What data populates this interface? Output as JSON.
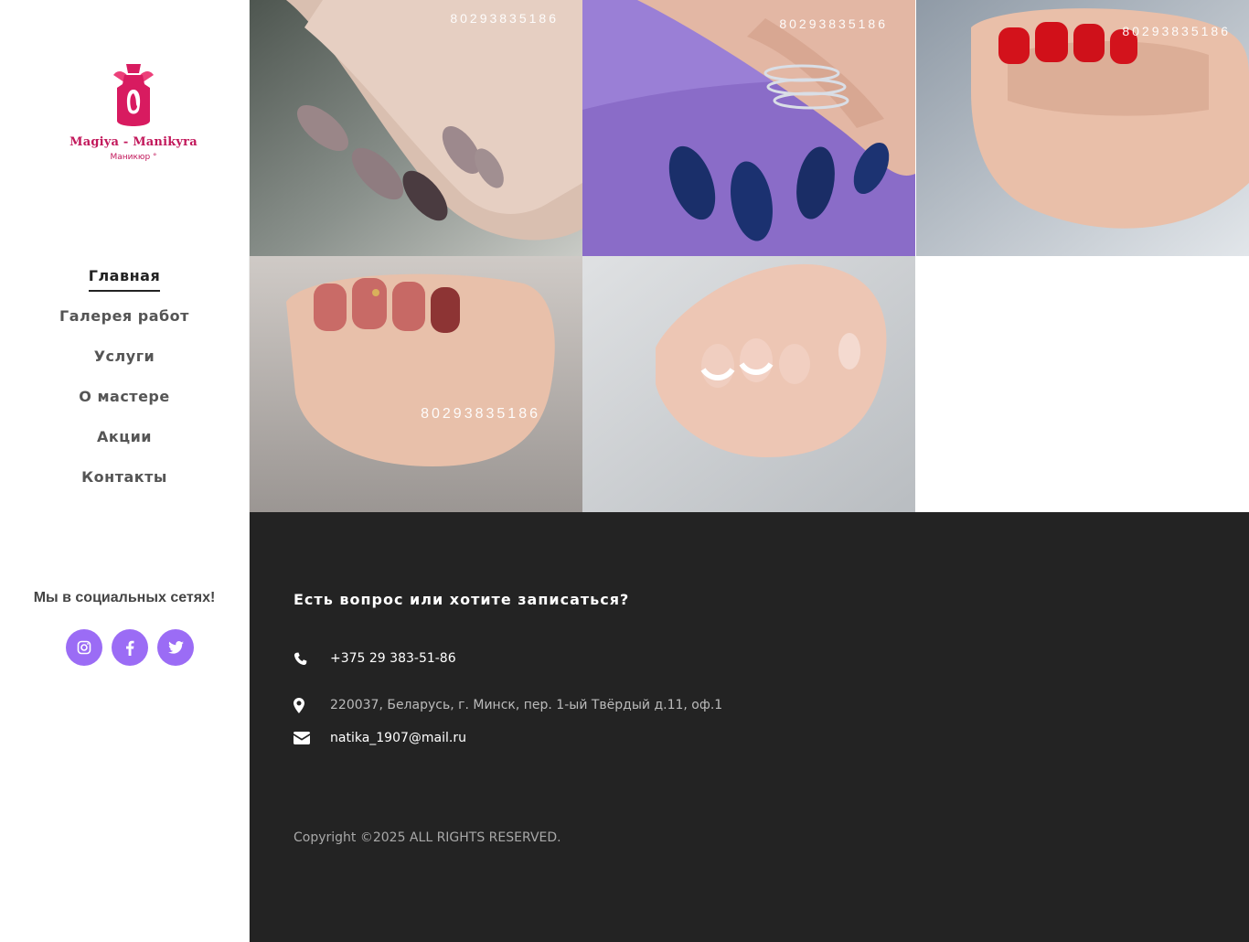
{
  "brand": {
    "name": "Magiya - Manikyra",
    "tagline": "Маникюр °"
  },
  "nav": {
    "items": [
      {
        "label": "Главная",
        "active": true
      },
      {
        "label": "Галерея работ"
      },
      {
        "label": "Услуги"
      },
      {
        "label": "О мастере"
      },
      {
        "label": "Акции"
      },
      {
        "label": "Контакты"
      }
    ]
  },
  "social": {
    "title": "Мы в социальных сетях!",
    "buttons": [
      "instagram-icon",
      "facebook-icon",
      "twitter-icon"
    ],
    "color": "#9b6cf5"
  },
  "gallery": {
    "watermark": "80293835186",
    "items": [
      {
        "description": "nude almond nails with glitter accent"
      },
      {
        "description": "navy blue shimmer nails with silver ring"
      },
      {
        "description": "red short nails"
      },
      {
        "description": "terracotta nails with gold accent"
      },
      {
        "description": "french manicure with lace accent"
      }
    ]
  },
  "contact": {
    "title": "Есть вопрос или хотите записаться?",
    "phone": "+375 29 383-51-86",
    "address": "220037, Беларусь, г. Минск, пер. 1-ый Твёрдый д.11, оф.1",
    "email": "natika_1907@mail.ru",
    "copyright": "Copyright ©2025 ALL RIGHTS RESERVED."
  },
  "colors": {
    "brand": "#c2185b",
    "footer_bg": "#232323",
    "accent": "#9b6cf5"
  }
}
